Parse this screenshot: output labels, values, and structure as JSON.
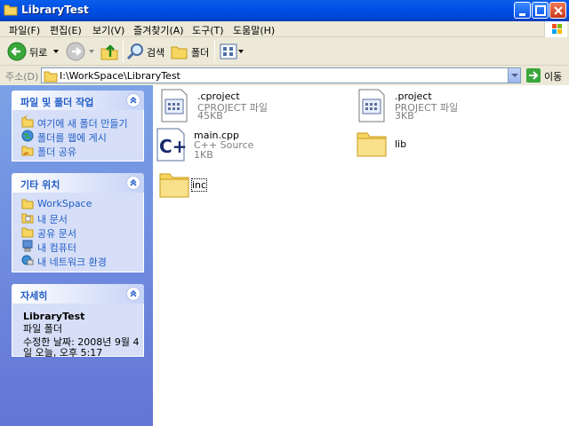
{
  "window": {
    "title": "LibraryTest"
  },
  "menu": [
    "파일(F)",
    "편집(E)",
    "보기(V)",
    "즐겨찾기(A)",
    "도구(T)",
    "도움말(H)"
  ],
  "toolbar": {
    "back_label": "뒤로",
    "search_label": "검색",
    "folders_label": "폴더"
  },
  "address": {
    "label": "주소(D)",
    "path": "I:\\WorkSpace\\LibraryTest",
    "go_label": "이동"
  },
  "tasks": {
    "file_folder": {
      "title": "파일 및 폴더 작업",
      "items": [
        "여기에 새 폴더 만들기",
        "폴더를 웹에 게시",
        "폴더 공유"
      ]
    },
    "other_places": {
      "title": "기타 위치",
      "items": [
        "WorkSpace",
        "내 문서",
        "공유 문서",
        "내 컴퓨터",
        "내 네트워크 환경"
      ]
    },
    "details": {
      "title": "자세히",
      "name": "LibraryTest",
      "type": "파일 폴더",
      "modified": "수정한 날짜: 2008년 9월 4일 오늘, 오후 5:17"
    }
  },
  "files": [
    {
      "name": ".cproject",
      "type": "CPROJECT 파일",
      "size": "45KB"
    },
    {
      "name": ".project",
      "type": "PROJECT 파일",
      "size": "3KB"
    },
    {
      "name": "main.cpp",
      "type": "C++ Source",
      "size": "1KB"
    },
    {
      "name": "lib"
    },
    {
      "name": "inc"
    }
  ],
  "colors": {
    "titlebar": "#0050e6",
    "task_text": "#215dc6",
    "task_body": "#d6dff7",
    "left_pane": "#7ba2e7"
  }
}
